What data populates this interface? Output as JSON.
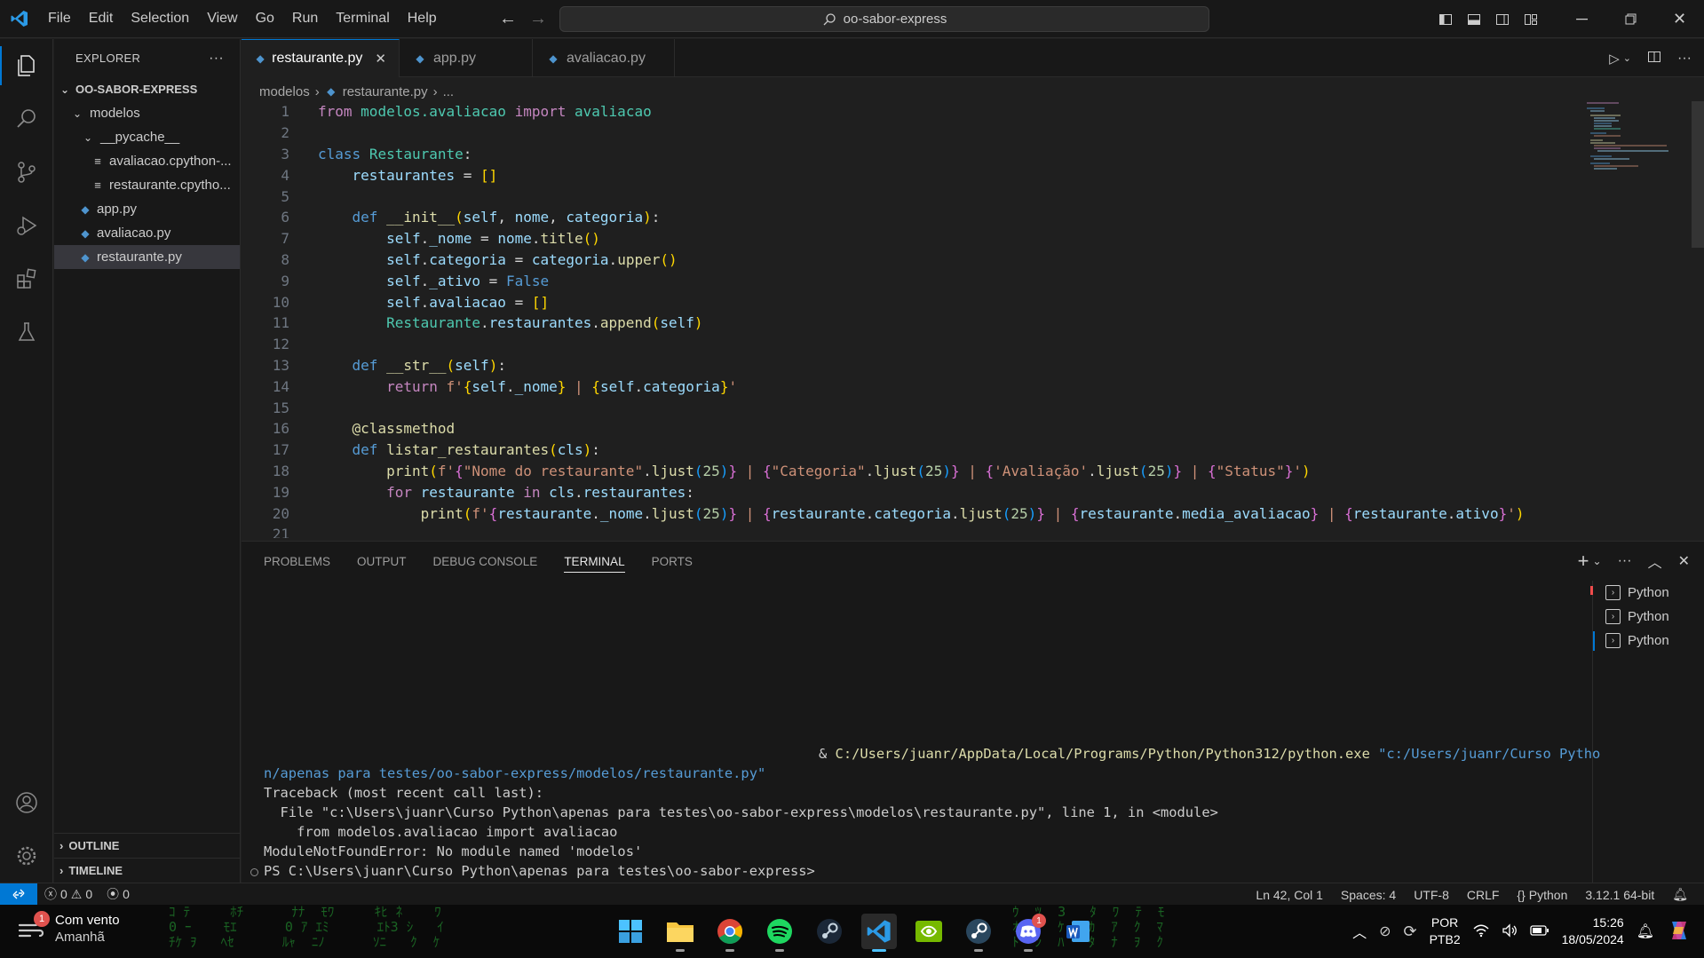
{
  "menu": [
    "File",
    "Edit",
    "Selection",
    "View",
    "Go",
    "Run",
    "Terminal",
    "Help"
  ],
  "search": {
    "text": "oo-sabor-express"
  },
  "sidebar": {
    "title": "EXPLORER",
    "root": "OO-SABOR-EXPRESS",
    "items": [
      {
        "label": "modelos"
      },
      {
        "label": "__pycache__"
      },
      {
        "label": "avaliacao.cpython-..."
      },
      {
        "label": "restaurante.cpytho..."
      },
      {
        "label": "app.py"
      },
      {
        "label": "avaliacao.py"
      },
      {
        "label": "restaurante.py"
      }
    ],
    "outline": "OUTLINE",
    "timeline": "TIMELINE"
  },
  "tabs": [
    {
      "label": "restaurante.py"
    },
    {
      "label": "app.py"
    },
    {
      "label": "avaliacao.py"
    }
  ],
  "breadcrumb": {
    "folder": "modelos",
    "file": "restaurante.py",
    "more": "..."
  },
  "code": {
    "line_numbers": [
      "1",
      "2",
      "3",
      "4",
      "5",
      "6",
      "7",
      "8",
      "9",
      "10",
      "11",
      "12",
      "13",
      "14",
      "15",
      "16",
      "17",
      "18",
      "19",
      "20",
      "21"
    ],
    "l1": [
      "from",
      "modelos.avaliacao",
      "import",
      "avaliacao"
    ],
    "l3": [
      "class",
      "Restaurante",
      ":"
    ],
    "l4": [
      "restaurantes",
      " = ",
      "[]"
    ],
    "l6": [
      "def",
      "__init__",
      "(",
      "self",
      ", ",
      "nome",
      ", ",
      "categoria",
      ")",
      ":"
    ],
    "l7": [
      "self",
      ".",
      "_nome",
      " = ",
      "nome",
      ".",
      "title",
      "()"
    ],
    "l8": [
      "self",
      ".",
      "categoria",
      " = ",
      "categoria",
      ".",
      "upper",
      "()"
    ],
    "l9": [
      "self",
      ".",
      "_ativo",
      " = ",
      "False"
    ],
    "l10": [
      "self",
      ".",
      "avaliacao",
      " = ",
      "[]"
    ],
    "l11": [
      "Restaurante",
      ".",
      "restaurantes",
      ".",
      "append",
      "(",
      "self",
      ")"
    ],
    "l13": [
      "def",
      "__str__",
      "(",
      "self",
      ")",
      ":"
    ],
    "l14": [
      "return",
      "f'",
      "{",
      "self",
      ".",
      "_nome",
      "}",
      " | ",
      "{",
      "self",
      ".",
      "categoria",
      "}",
      "'"
    ],
    "l16": [
      "@",
      "classmethod"
    ],
    "l17": [
      "def",
      "listar_restaurantes",
      "(",
      "cls",
      ")",
      ":"
    ],
    "l18": [
      "print",
      "(",
      "f'",
      "{",
      "\"Nome do restaurante\"",
      ".",
      "ljust",
      "(",
      "25",
      ")",
      "}",
      " | ",
      "{",
      "\"Categoria\"",
      ".",
      "ljust",
      "(",
      "25",
      ")",
      "}",
      " | ",
      "{",
      "'Avaliação'",
      ".",
      "ljust",
      "(",
      "25",
      ")",
      "}",
      " | ",
      "{",
      "\"Status\"",
      "}",
      "'",
      ")"
    ],
    "l19": [
      "for",
      "restaurante",
      "in",
      "cls",
      ".",
      "restaurantes",
      ":"
    ],
    "l20": [
      "print",
      "(",
      "f'",
      "{",
      "restaurante",
      ".",
      "_nome",
      ".",
      "ljust",
      "(",
      "25",
      ")",
      "}",
      " | ",
      "{",
      "restaurante",
      ".",
      "categoria",
      ".",
      "ljust",
      "(",
      "25",
      ")",
      "}",
      " | ",
      "{",
      "restaurante",
      ".",
      "media_avaliacao",
      "}",
      " | ",
      "{",
      "restaurante",
      ".",
      "ativo",
      "}",
      "'",
      ")"
    ]
  },
  "panel": {
    "tabs": [
      "PROBLEMS",
      "OUTPUT",
      "DEBUG CONSOLE",
      "TERMINAL",
      "PORTS"
    ],
    "terminals": [
      "Python",
      "Python",
      "Python"
    ],
    "terminal": {
      "cmd_amp": "& ",
      "cmd_exe": "C:/Users/juanr/AppData/Local/Programs/Python/Python312/python.exe",
      "cmd_arg1": "\"c:/Users/juanr/Curso Pytho",
      "cmd_arg2": "n/apenas para testes/oo-sabor-express/modelos/restaurante.py\"",
      "tb1": "Traceback (most recent call last):",
      "tb2": "  File \"c:\\Users\\juanr\\Curso Python\\apenas para testes\\oo-sabor-express\\modelos\\restaurante.py\", line 1, in <module>",
      "tb3": "    from modelos.avaliacao import avaliacao",
      "tb4": "ModuleNotFoundError: No module named 'modelos'",
      "prompt": "PS C:\\Users\\juanr\\Curso Python\\apenas para testes\\oo-sabor-express>"
    }
  },
  "statusbar": {
    "errors": "0",
    "warnings": "0",
    "ports": "0",
    "position": "Ln 42, Col 1",
    "spaces": "Spaces: 4",
    "encoding": "UTF-8",
    "eol": "CRLF",
    "language": "Python",
    "interpreter": "3.12.1 64-bit"
  },
  "taskbar": {
    "weather_title": "Com vento",
    "weather_sub": "Amanhã",
    "weather_badge": "1",
    "discord_badge": "1",
    "lang1": "POR",
    "lang2": "PTB2",
    "time": "15:26",
    "date": "18/05/2024"
  },
  "colors": {
    "accent": "#0078d4",
    "background": "#1f1f1f",
    "chrome": "#181818"
  }
}
